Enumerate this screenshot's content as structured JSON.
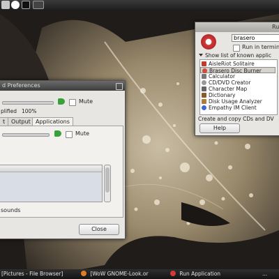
{
  "desktop": {
    "top_panel": {
      "icons": [
        "app-menu-icon",
        "gear-icon",
        "terminal-icon",
        "workspace-icon"
      ]
    },
    "taskbar": {
      "items": [
        {
          "label": "[Pictures - File Browser]",
          "icon": "folder-icon"
        },
        {
          "label": "[WoW GNOME-Look.or",
          "icon": "firefox-icon"
        },
        {
          "label": "Run Application",
          "icon": "run-icon"
        },
        {
          "label": "...",
          "icon": ""
        }
      ]
    }
  },
  "sound_prefs": {
    "title": "d Preferences",
    "mute1_label": "Mute",
    "amplified_label": "plified",
    "amplified_value": "100%",
    "tabs": [
      {
        "label": "t"
      },
      {
        "label": "Output"
      },
      {
        "label": "Applications"
      }
    ],
    "mute2_label": "Mute",
    "sounds_label": "sounds",
    "close_label": "Close",
    "output_volume": 0.6,
    "app_volume": 0.55
  },
  "run_dialog": {
    "title": "Ru",
    "command_value": "brasero",
    "run_in_terminal_label": "Run in termin",
    "show_list_label": "Show list of known applic",
    "apps": [
      {
        "label": "AisleRiot Solitaire",
        "icon": "cards-icon",
        "color": "#c23a2a"
      },
      {
        "label": "Brasero Disc Burner",
        "icon": "disc-burner-icon",
        "color": "#d14a3a",
        "selected": true
      },
      {
        "label": "Calculator",
        "icon": "calculator-icon",
        "color": "#777777"
      },
      {
        "label": "CD/DVD Creator",
        "icon": "cd-icon",
        "color": "#999999"
      },
      {
        "label": "Character Map",
        "icon": "character-map-icon",
        "color": "#666666"
      },
      {
        "label": "Dictionary",
        "icon": "dictionary-icon",
        "color": "#8a5a2a"
      },
      {
        "label": "Disk Usage Analyzer",
        "icon": "disk-usage-icon",
        "color": "#b07a3a"
      },
      {
        "label": "Empathy IM Client",
        "icon": "empathy-icon",
        "color": "#3a6ad1"
      }
    ],
    "description": "Create and copy CDs and DV",
    "help_label": "Help"
  },
  "colors": {
    "panel": "#1e1e1e",
    "window_bg": "#e8e6e2",
    "accent_volume": "#3aa13a"
  }
}
